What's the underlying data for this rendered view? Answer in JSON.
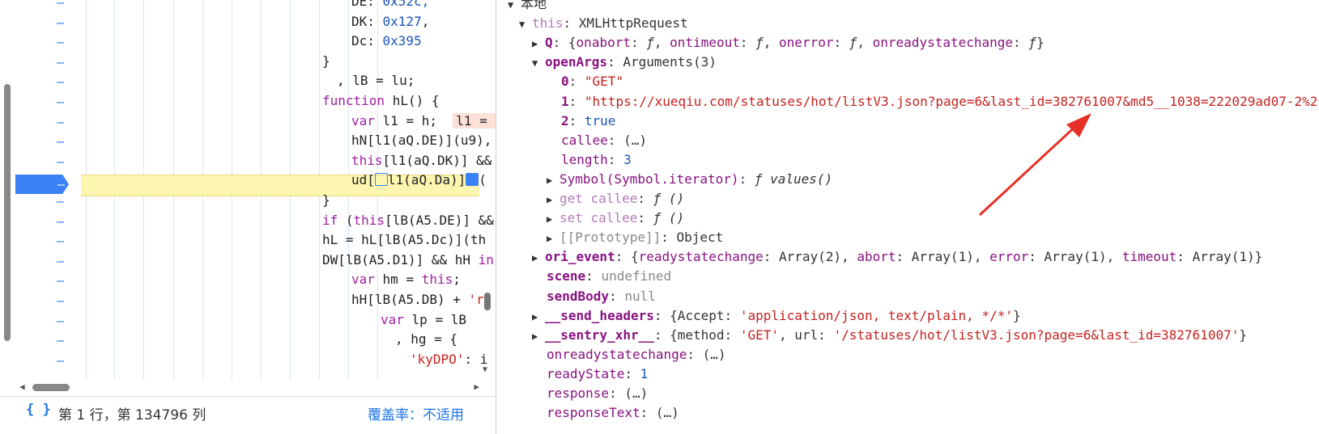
{
  "editor": {
    "code_lines": [
      {
        "id": "l0",
        "parts": [
          {
            "t": "DE: ",
            "c": ""
          },
          {
            "t": "0x52c,",
            "c": "num"
          }
        ]
      },
      {
        "id": "l1",
        "parts": [
          {
            "t": "DK: ",
            "c": ""
          },
          {
            "t": "0x127",
            "c": "num"
          },
          {
            "t": ",",
            "c": ""
          }
        ]
      },
      {
        "id": "l2",
        "parts": [
          {
            "t": "Dc: ",
            "c": ""
          },
          {
            "t": "0x395",
            "c": "num"
          }
        ]
      },
      {
        "id": "l3",
        "parts": [
          {
            "t": "}",
            "c": ""
          }
        ]
      },
      {
        "id": "l4",
        "parts": [
          {
            "t": ", lB = lu;",
            "c": ""
          }
        ]
      },
      {
        "id": "l5",
        "parts": [
          {
            "t": "function",
            "c": "kw"
          },
          {
            "t": " hL() {",
            "c": ""
          }
        ]
      },
      {
        "id": "l6",
        "parts": [
          {
            "t": "var",
            "c": "kw"
          },
          {
            "t": " l1 = h;  ",
            "c": ""
          },
          {
            "t": "l1 = ",
            "c": "hint"
          }
        ]
      },
      {
        "id": "l7",
        "parts": [
          {
            "t": "hN[l1(aQ.DE)](u9),",
            "c": ""
          }
        ]
      },
      {
        "id": "l8",
        "parts": [
          {
            "t": "this",
            "c": "kw"
          },
          {
            "t": "[l1(aQ.DK)] &&",
            "c": ""
          }
        ]
      },
      {
        "id": "l9",
        "parts": [
          {
            "t": "ud[",
            "c": ""
          },
          {
            "t": "",
            "c": "mark"
          },
          {
            "t": "l1(aQ.Da)]",
            "c": ""
          },
          {
            "t": "",
            "c": "markf"
          },
          {
            "t": "(",
            "c": ""
          }
        ]
      },
      {
        "id": "l10",
        "parts": [
          {
            "t": "}",
            "c": ""
          }
        ]
      },
      {
        "id": "l11",
        "parts": [
          {
            "t": "if",
            "c": "kw"
          },
          {
            "t": " (",
            "c": ""
          },
          {
            "t": "this",
            "c": "kw"
          },
          {
            "t": "[lB(A5.DE)] &&",
            "c": ""
          }
        ]
      },
      {
        "id": "l12",
        "parts": [
          {
            "t": "hL = hL[lB(A5.Dc)](th",
            "c": ""
          }
        ]
      },
      {
        "id": "l13",
        "parts": [
          {
            "t": "DW[lB(A5.D1)] && hH ",
            "c": ""
          },
          {
            "t": "in",
            "c": "kw"
          }
        ]
      },
      {
        "id": "l14",
        "parts": [
          {
            "t": "var",
            "c": "kw"
          },
          {
            "t": " hm = ",
            "c": ""
          },
          {
            "t": "this",
            "c": "kw"
          },
          {
            "t": ";",
            "c": ""
          }
        ]
      },
      {
        "id": "l15",
        "parts": [
          {
            "t": "hH[lB(A5.DB) + ",
            "c": ""
          },
          {
            "t": "'r'",
            "c": "str"
          }
        ]
      },
      {
        "id": "l16",
        "parts": [
          {
            "t": "var",
            "c": "kw"
          },
          {
            "t": " lp = lB",
            "c": ""
          }
        ]
      },
      {
        "id": "l17",
        "parts": [
          {
            "t": ", hg = {",
            "c": ""
          }
        ]
      },
      {
        "id": "l18",
        "parts": [
          {
            "t": "'kyDPO'",
            "c": "str"
          },
          {
            "t": ": i",
            "c": ""
          }
        ]
      }
    ],
    "gutter_marker": "–",
    "breakpoint_marker": "–",
    "status": {
      "braces": "{ }",
      "position": "第 1 行，第 134796 列",
      "coverage": "覆盖率：不适用"
    }
  },
  "scope": {
    "rows": [
      {
        "id": "r0",
        "parts": [
          {
            "t": "▼ ",
            "c": "tri"
          },
          {
            "t": "本地",
            "c": "meta"
          }
        ]
      },
      {
        "id": "r1",
        "parts": [
          {
            "t": "▼ ",
            "c": "tri"
          },
          {
            "t": "this",
            "c": "keyg"
          },
          {
            "t": ": XMLHttpRequest",
            "c": "meta"
          }
        ]
      },
      {
        "id": "r2",
        "parts": [
          {
            "t": "▶ ",
            "c": "tri"
          },
          {
            "t": "Q",
            "c": "keyb"
          },
          {
            "t": ": {",
            "c": "meta"
          },
          {
            "t": "onabort",
            "c": "key"
          },
          {
            "t": ": ",
            "c": "meta"
          },
          {
            "t": "ƒ",
            "c": "fi"
          },
          {
            "t": ", ",
            "c": "meta"
          },
          {
            "t": "ontimeout",
            "c": "key"
          },
          {
            "t": ": ",
            "c": "meta"
          },
          {
            "t": "ƒ",
            "c": "fi"
          },
          {
            "t": ", ",
            "c": "meta"
          },
          {
            "t": "onerror",
            "c": "key"
          },
          {
            "t": ": ",
            "c": "meta"
          },
          {
            "t": "ƒ",
            "c": "fi"
          },
          {
            "t": ", ",
            "c": "meta"
          },
          {
            "t": "onreadystatechange",
            "c": "key"
          },
          {
            "t": ": ",
            "c": "meta"
          },
          {
            "t": "ƒ",
            "c": "fi"
          },
          {
            "t": "}",
            "c": "meta"
          }
        ]
      },
      {
        "id": "r3",
        "parts": [
          {
            "t": "▼ ",
            "c": "tri"
          },
          {
            "t": "openArgs",
            "c": "keyb"
          },
          {
            "t": ": Arguments(3)",
            "c": "meta"
          }
        ]
      },
      {
        "id": "r4",
        "parts": [
          {
            "t": "0",
            "c": "keyb"
          },
          {
            "t": ": ",
            "c": "meta"
          },
          {
            "t": "\"GET\"",
            "c": "sv"
          }
        ]
      },
      {
        "id": "r5",
        "parts": [
          {
            "t": "1",
            "c": "keyb"
          },
          {
            "t": ": ",
            "c": "meta"
          },
          {
            "t": "\"https://xueqiu.com/statuses/hot/listV3.json?page=6&last_id=382761007&md5__1038=222029ad07-2%2",
            "c": "sv"
          }
        ]
      },
      {
        "id": "r6",
        "parts": [
          {
            "t": "2",
            "c": "keyb"
          },
          {
            "t": ": ",
            "c": "meta"
          },
          {
            "t": "true",
            "c": "nv"
          }
        ]
      },
      {
        "id": "r7",
        "parts": [
          {
            "t": "callee",
            "c": "key"
          },
          {
            "t": ": (…)",
            "c": "meta"
          }
        ]
      },
      {
        "id": "r8",
        "parts": [
          {
            "t": "length",
            "c": "key"
          },
          {
            "t": ": ",
            "c": "meta"
          },
          {
            "t": "3",
            "c": "nv"
          }
        ]
      },
      {
        "id": "r9",
        "parts": [
          {
            "t": "▶ ",
            "c": "tri"
          },
          {
            "t": "Symbol(Symbol.iterator)",
            "c": "key"
          },
          {
            "t": ": ",
            "c": "meta"
          },
          {
            "t": "ƒ values()",
            "c": "fi"
          }
        ]
      },
      {
        "id": "r10",
        "parts": [
          {
            "t": "▶ ",
            "c": "tri"
          },
          {
            "t": "get callee",
            "c": "keyg"
          },
          {
            "t": ": ",
            "c": "meta"
          },
          {
            "t": "ƒ ()",
            "c": "fi"
          }
        ]
      },
      {
        "id": "r11",
        "parts": [
          {
            "t": "▶ ",
            "c": "tri"
          },
          {
            "t": "set callee",
            "c": "keyg"
          },
          {
            "t": ": ",
            "c": "meta"
          },
          {
            "t": "ƒ ()",
            "c": "fi"
          }
        ]
      },
      {
        "id": "r12",
        "parts": [
          {
            "t": "▶ ",
            "c": "tri"
          },
          {
            "t": "[[Prototype]]",
            "c": "gray"
          },
          {
            "t": ": Object",
            "c": "meta"
          }
        ]
      },
      {
        "id": "r13",
        "parts": [
          {
            "t": "▶ ",
            "c": "tri"
          },
          {
            "t": "ori_event",
            "c": "keyb"
          },
          {
            "t": ": {",
            "c": "meta"
          },
          {
            "t": "readystatechange",
            "c": "key"
          },
          {
            "t": ": Array(2), ",
            "c": "meta"
          },
          {
            "t": "abort",
            "c": "key"
          },
          {
            "t": ": Array(1), ",
            "c": "meta"
          },
          {
            "t": "error",
            "c": "key"
          },
          {
            "t": ": Array(1), ",
            "c": "meta"
          },
          {
            "t": "timeout",
            "c": "key"
          },
          {
            "t": ": Array(1)}",
            "c": "meta"
          }
        ]
      },
      {
        "id": "r14",
        "parts": [
          {
            "t": "scene",
            "c": "keyb"
          },
          {
            "t": ": ",
            "c": "meta"
          },
          {
            "t": "undefined",
            "c": "gray"
          }
        ]
      },
      {
        "id": "r15",
        "parts": [
          {
            "t": "sendBody",
            "c": "keyb"
          },
          {
            "t": ": ",
            "c": "meta"
          },
          {
            "t": "null",
            "c": "gray"
          }
        ]
      },
      {
        "id": "r16",
        "parts": [
          {
            "t": "▶ ",
            "c": "tri"
          },
          {
            "t": "__send_headers",
            "c": "keyb"
          },
          {
            "t": ": {Accept: ",
            "c": "meta"
          },
          {
            "t": "'application/json, text/plain, */*'",
            "c": "sv"
          },
          {
            "t": "}",
            "c": "meta"
          }
        ]
      },
      {
        "id": "r17",
        "parts": [
          {
            "t": "▶ ",
            "c": "tri"
          },
          {
            "t": "__sentry_xhr__",
            "c": "keyb"
          },
          {
            "t": ": {method: ",
            "c": "meta"
          },
          {
            "t": "'GET'",
            "c": "sv"
          },
          {
            "t": ", url: ",
            "c": "meta"
          },
          {
            "t": "'/statuses/hot/listV3.json?page=6&last_id=382761007'",
            "c": "sv"
          },
          {
            "t": "}",
            "c": "meta"
          }
        ]
      },
      {
        "id": "r18",
        "parts": [
          {
            "t": "onreadystatechange",
            "c": "key"
          },
          {
            "t": ": (…)",
            "c": "meta"
          }
        ]
      },
      {
        "id": "r19",
        "parts": [
          {
            "t": "readyState",
            "c": "key"
          },
          {
            "t": ": ",
            "c": "meta"
          },
          {
            "t": "1",
            "c": "nv"
          }
        ]
      },
      {
        "id": "r20",
        "parts": [
          {
            "t": "response",
            "c": "key"
          },
          {
            "t": ": (…)",
            "c": "meta"
          }
        ]
      },
      {
        "id": "r21",
        "parts": [
          {
            "t": "responseText",
            "c": "key"
          },
          {
            "t": ": (…)",
            "c": "meta"
          }
        ]
      }
    ]
  },
  "colors": {
    "annotation_arrow": "#e8302a",
    "execution_highlight": "#fdf6b0",
    "breakpoint": "#3b82f6"
  }
}
